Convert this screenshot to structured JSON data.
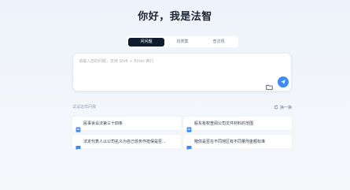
{
  "header": {
    "title": "你好，我是法智"
  },
  "tabs": [
    {
      "label": "问问题",
      "active": true
    },
    {
      "label": "找类案",
      "active": false
    },
    {
      "label": "查法规",
      "active": false
    }
  ],
  "input": {
    "placeholder": "请输入您的问题，支持 Shift + Enter 换行",
    "value": ""
  },
  "suggestions": {
    "label": "试试这样问我",
    "refresh_label": "换一换",
    "items": [
      {
        "text": "民事诉讼法第三十四条",
        "icon": "document-icon"
      },
      {
        "text": "股东有权查阅公司文件材料的范围",
        "icon": "document-icon"
      },
      {
        "text": "法定代表人以公司名义为自己债务作担保是否...",
        "icon": "chat-icon"
      },
      {
        "text": "賭债是否在不同地区有不同量刑金额标准",
        "icon": "chat-icon"
      }
    ]
  },
  "colors": {
    "accent": "#3d8bf5",
    "tab_active": "#111b2e"
  }
}
